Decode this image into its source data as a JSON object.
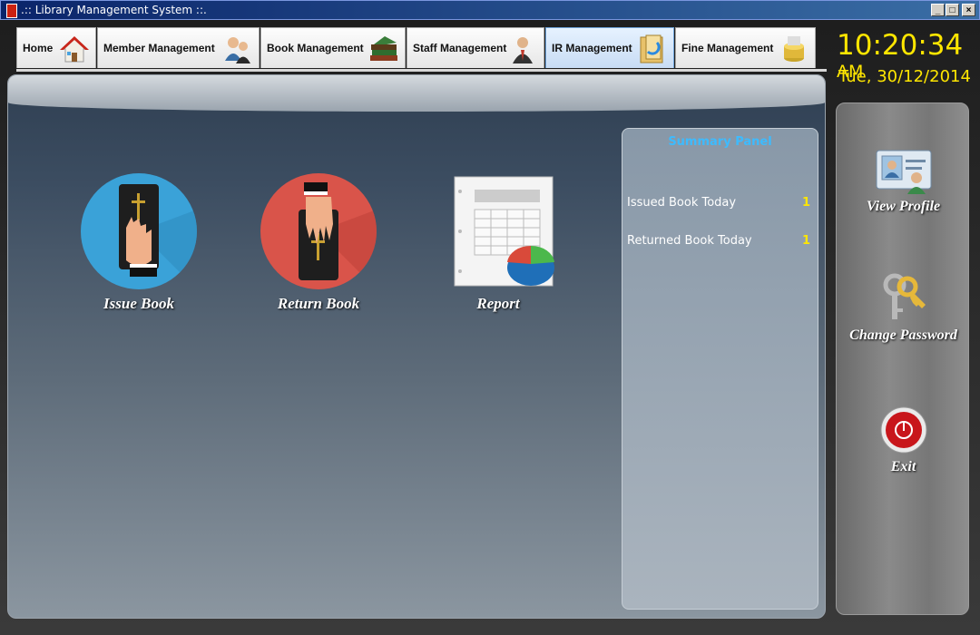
{
  "window": {
    "title": ".:: Library Management System ::."
  },
  "tabs": [
    {
      "label": "Home",
      "icon": "house-icon"
    },
    {
      "label": "Member Management",
      "icon": "members-icon"
    },
    {
      "label": "Book Management",
      "icon": "books-icon"
    },
    {
      "label": "Staff Management",
      "icon": "staff-icon"
    },
    {
      "label": "IR Management",
      "icon": "ir-icon",
      "active": true
    },
    {
      "label": "Fine Management",
      "icon": "money-icon"
    }
  ],
  "clock": {
    "time": "10:20:34",
    "ampm": "AM",
    "date": "Tue, 30/12/2014"
  },
  "actions": {
    "issue": {
      "label": "Issue Book"
    },
    "return": {
      "label": "Return Book"
    },
    "report": {
      "label": "Report"
    }
  },
  "summary": {
    "title": "Summary Panel",
    "issued_label": "Issued Book Today",
    "issued_value": "1",
    "returned_label": "Returned Book Today",
    "returned_value": "1"
  },
  "side": {
    "profile": "View Profile",
    "password": "Change Password",
    "exit": "Exit"
  },
  "colors": {
    "accent": "#ffe600",
    "summary_title": "#3dbbff",
    "issue_circle": "#3aa2d8",
    "return_circle": "#d9544a"
  }
}
